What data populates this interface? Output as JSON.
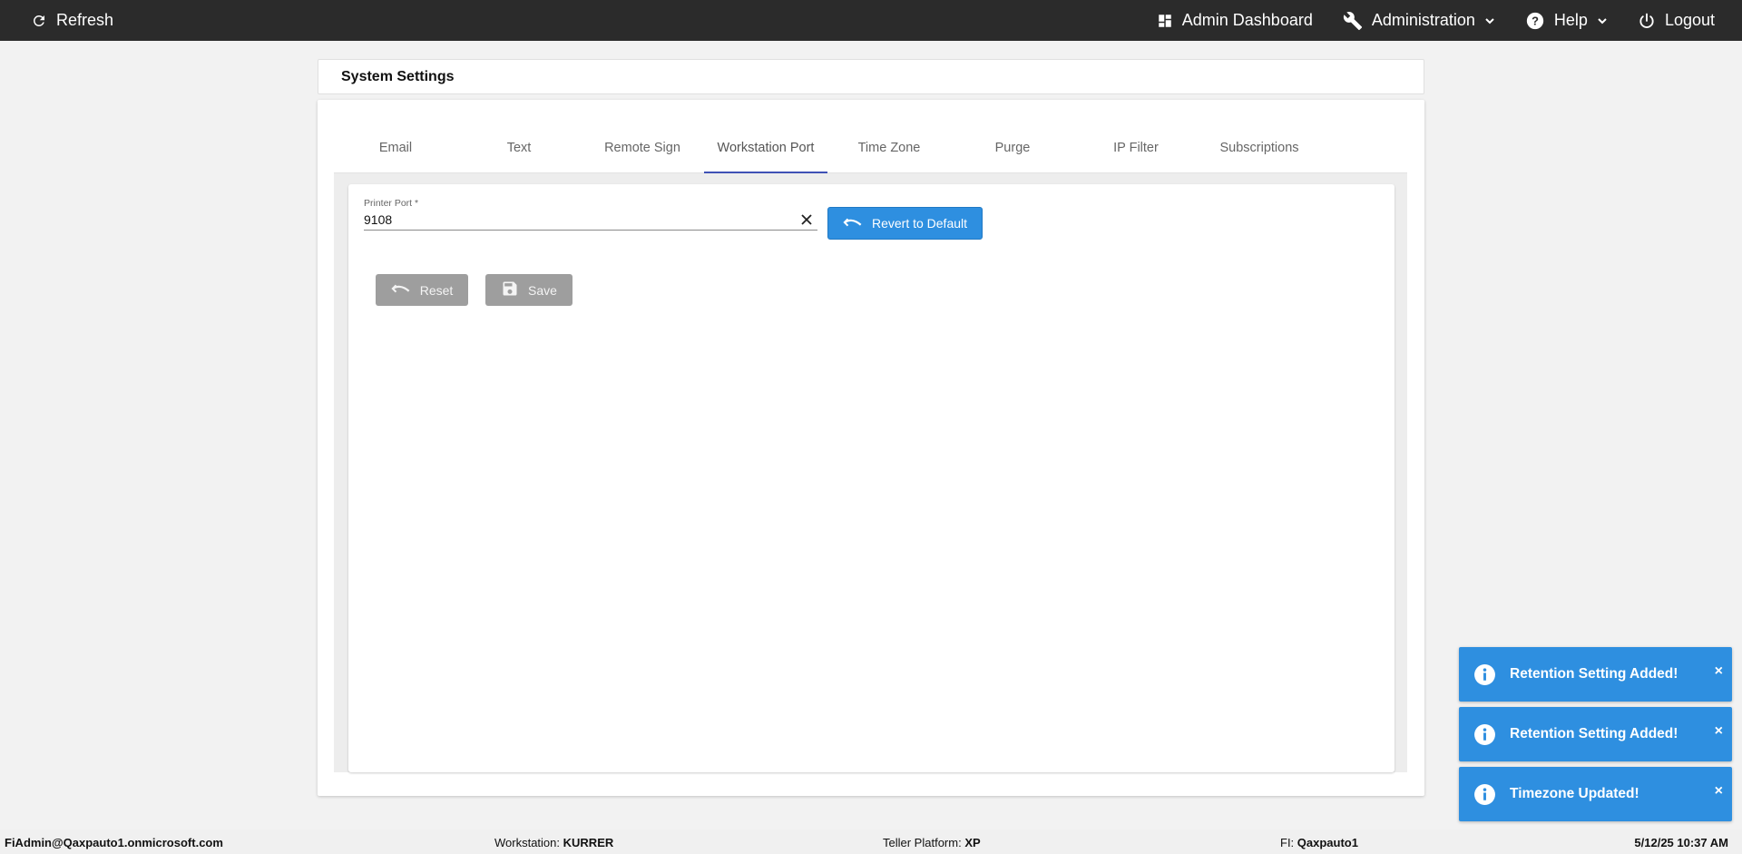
{
  "topbar": {
    "refresh_label": "Refresh",
    "admin_dashboard_label": "Admin Dashboard",
    "administration_label": "Administration",
    "help_label": "Help",
    "logout_label": "Logout"
  },
  "page": {
    "title": "System Settings"
  },
  "tabs": [
    {
      "label": "Email"
    },
    {
      "label": "Text"
    },
    {
      "label": "Remote Sign"
    },
    {
      "label": "Workstation Port",
      "active": true
    },
    {
      "label": "Time Zone"
    },
    {
      "label": "Purge"
    },
    {
      "label": "IP Filter"
    },
    {
      "label": "Subscriptions"
    }
  ],
  "form": {
    "printer_port_label": "Printer Port *",
    "printer_port_value": "9108",
    "revert_label": "Revert to Default",
    "reset_label": "Reset",
    "save_label": "Save"
  },
  "toasts": [
    {
      "message": "Retention Setting Added!",
      "close": "×"
    },
    {
      "message": "Retention Setting Added!",
      "close": "×"
    },
    {
      "message": "Timezone Updated!",
      "close": "×"
    }
  ],
  "footer": {
    "user": "FiAdmin@Qaxpauto1.onmicrosoft.com",
    "workstation_label": "Workstation:",
    "workstation_value": "KURRER",
    "platform_label": "Teller Platform:",
    "platform_value": "XP",
    "fi_label": "FI:",
    "fi_value": "Qaxpauto1",
    "datetime": "5/12/25 10:37 AM"
  },
  "colors": {
    "topbar": "#2b2b2b",
    "primary": "#2e8fe0",
    "tab_indicator": "#3f51b5",
    "disabled_button": "#9e9e9e"
  },
  "icons": {
    "refresh": "refresh-icon",
    "dashboard": "dashboard-icon",
    "administration": "wrench-icon",
    "help": "help-circle-icon",
    "logout": "power-icon",
    "revert": "undo-icon",
    "reset": "undo-icon",
    "save": "floppy-icon",
    "toast": "info-icon"
  }
}
